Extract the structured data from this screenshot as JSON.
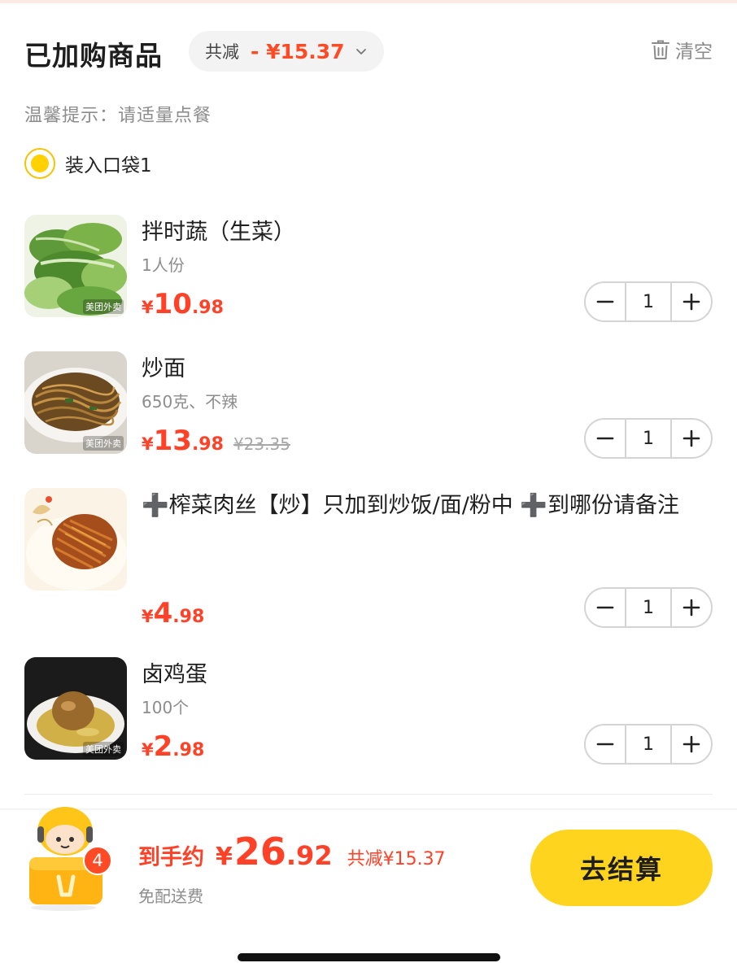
{
  "header": {
    "title": "已加购商品",
    "discount_label": "共减",
    "discount_amount": "- ¥15.37",
    "clear_label": "清空"
  },
  "tip": "温馨提示：请适量点餐",
  "bag": {
    "label": "装入口袋1",
    "selected": true
  },
  "items": [
    {
      "name": "拌时蔬（生菜）",
      "spec": "1人份",
      "price_currency": "¥",
      "price_int": "10",
      "price_dec": ".98",
      "original_price": "",
      "quantity": "1",
      "image": "lettuce-dish"
    },
    {
      "name": "炒面",
      "spec": "650克、不辣",
      "price_currency": "¥",
      "price_int": "13",
      "price_dec": ".98",
      "original_price": "¥23.35",
      "quantity": "1",
      "image": "fried-noodles"
    },
    {
      "name": "➕榨菜肉丝【炒】只加到炒饭/面/粉中 ➕到哪份请备注",
      "spec": "",
      "price_currency": "¥",
      "price_int": "4",
      "price_dec": ".98",
      "original_price": "",
      "quantity": "1",
      "image": "pork-strips"
    },
    {
      "name": "卤鸡蛋",
      "spec": "100个",
      "price_currency": "¥",
      "price_int": "2",
      "price_dec": ".98",
      "original_price": "",
      "quantity": "1",
      "image": "braised-egg"
    }
  ],
  "image_watermark": "美团外卖",
  "footer": {
    "cart_count": "4",
    "total_prefix": "到手约",
    "total_currency": "¥",
    "total_int": "26",
    "total_dec": ".92",
    "total_saving": "共减¥15.37",
    "shipping": "免配送费",
    "checkout_label": "去结算"
  },
  "colors": {
    "accent": "#ff4128",
    "checkout_bg": "#ffd41f",
    "radio": "#ffd100"
  }
}
